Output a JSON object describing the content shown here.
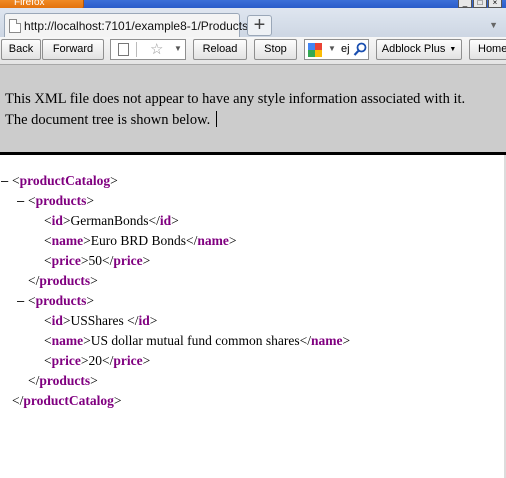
{
  "window": {
    "app_label": "Firefox",
    "controls": [
      "_",
      "□",
      "×"
    ]
  },
  "tab": {
    "title": "http://localhost:7101/example8-1/Products",
    "new_tab_label": "+"
  },
  "toolbar": {
    "back_label": "Back",
    "forward_label": "Forward",
    "reload_label": "Reload",
    "stop_label": "Stop",
    "search_text": "ej",
    "adblock_label": "Adblock Plus",
    "home_label": "Home"
  },
  "notice": {
    "line1": "This XML file does not appear to have any style information associated with it.",
    "line2": "The document tree is shown below."
  },
  "xml": {
    "root": "productCatalog",
    "products_tag": "products",
    "id_tag": "id",
    "name_tag": "name",
    "price_tag": "price",
    "items": [
      {
        "id": "GermanBonds",
        "name": "Euro BRD Bonds",
        "price": "50"
      },
      {
        "id": "USShares ",
        "name": "US dollar mutual fund common shares",
        "price": "20"
      }
    ]
  },
  "icons": {
    "page": "page-icon",
    "bookmark": "star-icon",
    "search_engine": "google-icon",
    "search": "magnifier-icon"
  },
  "colors": {
    "tag": "#800080",
    "notice_bg": "#cccccc",
    "firefox_button": "#e8790f"
  }
}
